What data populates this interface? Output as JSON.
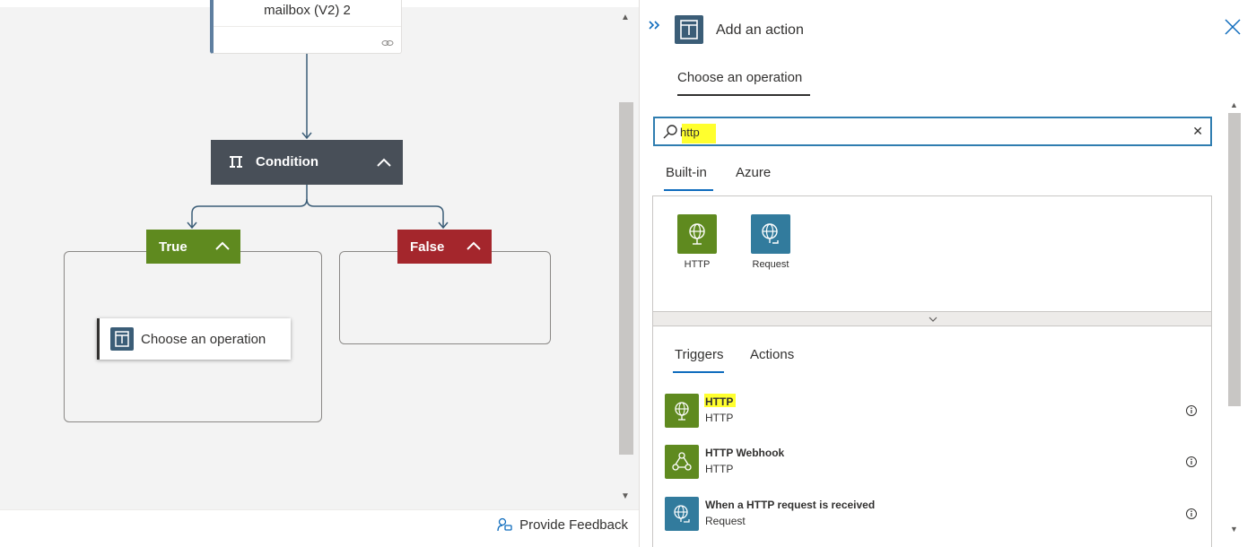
{
  "canvas": {
    "mailbox_card": {
      "title": "mailbox (V2) 2"
    },
    "condition": {
      "label": "Condition"
    },
    "true_branch": {
      "label": "True"
    },
    "false_branch": {
      "label": "False"
    },
    "choose_card": {
      "label": "Choose an operation"
    },
    "feedback": {
      "label": "Provide Feedback"
    }
  },
  "panel": {
    "title": "Add an action",
    "tab_label": "Choose an operation",
    "search": {
      "value": "http",
      "placeholder": ""
    },
    "source_tabs": [
      {
        "label": "Built-in",
        "active": true
      },
      {
        "label": "Azure",
        "active": false
      }
    ],
    "connectors": [
      {
        "name": "HTTP",
        "color": "#5f8a1f",
        "icon": "globe-icon"
      },
      {
        "name": "Request",
        "color": "#327b9d",
        "icon": "globe-request-icon"
      }
    ],
    "list_tabs": [
      {
        "label": "Triggers",
        "active": true
      },
      {
        "label": "Actions",
        "active": false
      }
    ],
    "operations": [
      {
        "name": "HTTP",
        "connector": "HTTP",
        "icon": "globe-icon",
        "highlighted": true
      },
      {
        "name": "HTTP Webhook",
        "connector": "HTTP",
        "icon": "webhook-icon",
        "highlighted": false
      },
      {
        "name": "When a HTTP request is received",
        "connector": "Request",
        "icon": "globe-request-icon",
        "highlighted": false
      }
    ]
  },
  "colors": {
    "accent": "#0f6cbd",
    "condition_header": "#484f58",
    "true_branch": "#5f8a1f",
    "false_branch": "#a4262c",
    "highlight": "#ffff2e"
  }
}
